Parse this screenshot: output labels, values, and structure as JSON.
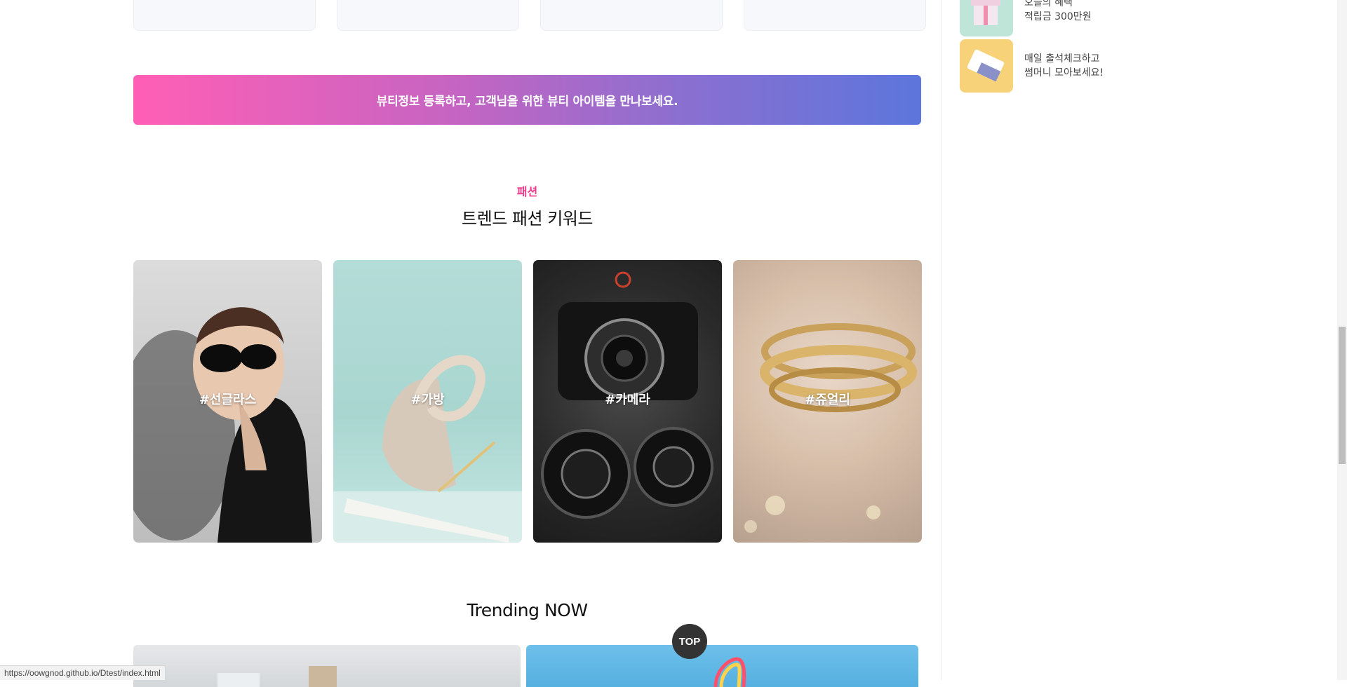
{
  "banner": {
    "text": "뷰티정보 등록하고, 고객님을 위한 뷰티 아이템을 만나보세요."
  },
  "fashion": {
    "category": "패션",
    "title": "트렌드 패션 키워드",
    "keywords": [
      "#선글라스",
      "#가방",
      "#카메라",
      "#쥬얼리"
    ]
  },
  "trending": {
    "title": "Trending NOW"
  },
  "top_button": {
    "label": "TOP"
  },
  "sidebar": {
    "promos": [
      {
        "line1": "오늘의 혜택",
        "line2": "적립금 300만원"
      },
      {
        "line1": "매일 출석체크하고",
        "line2": "썸머니 모아보세요!"
      }
    ]
  },
  "status_url": "https://oowgnod.github.io/Dtest/index.html"
}
